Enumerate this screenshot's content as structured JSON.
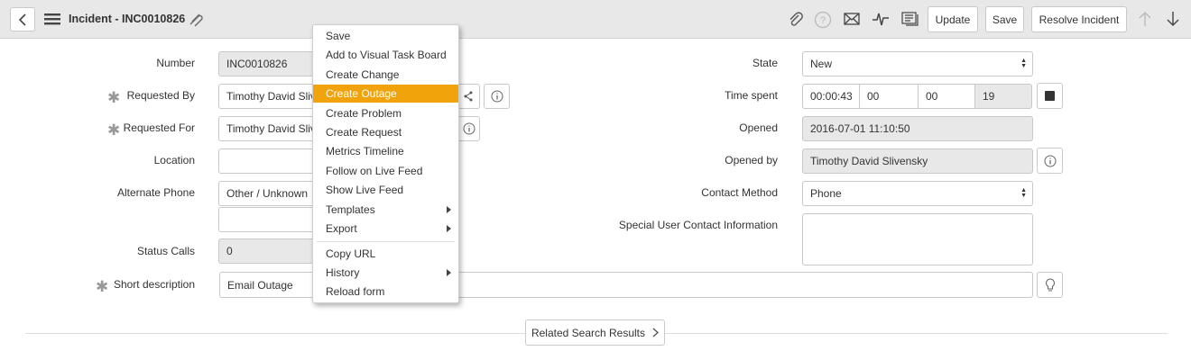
{
  "header": {
    "title": "Incident - INC0010826",
    "update_label": "Update",
    "save_label": "Save",
    "resolve_label": "Resolve Incident"
  },
  "form": {
    "number": {
      "label": "Number",
      "value": "INC0010826"
    },
    "requested_by": {
      "label": "Requested By",
      "value": "Timothy David Slivensky"
    },
    "requested_for": {
      "label": "Requested For",
      "value": "Timothy David Slivensky"
    },
    "location": {
      "label": "Location",
      "value": ""
    },
    "alternate_phone": {
      "label": "Alternate Phone",
      "value": "Other / Unknown",
      "value2": ""
    },
    "status_calls": {
      "label": "Status Calls",
      "value": "0"
    },
    "short_description": {
      "label": "Short description",
      "value": "Email Outage"
    },
    "state": {
      "label": "State",
      "value": "New"
    },
    "time_spent": {
      "label": "Time spent",
      "hours": "00:00:43",
      "h": "00",
      "m": "00",
      "s": "19"
    },
    "opened": {
      "label": "Opened",
      "value": "2016-07-01 11:10:50"
    },
    "opened_by": {
      "label": "Opened by",
      "value": "Timothy David Slivensky"
    },
    "contact_method": {
      "label": "Contact Method",
      "value": "Phone"
    },
    "special_contact": {
      "label": "Special User Contact Information",
      "value": ""
    }
  },
  "related_search_label": "Related Search Results",
  "context_menu": {
    "items": [
      {
        "label": "Save"
      },
      {
        "label": "Add to Visual Task Board"
      },
      {
        "label": "Create Change"
      },
      {
        "label": "Create Outage"
      },
      {
        "label": "Create Problem"
      },
      {
        "label": "Create Request"
      },
      {
        "label": "Metrics Timeline"
      },
      {
        "label": "Follow on Live Feed"
      },
      {
        "label": "Show Live Feed"
      },
      {
        "label": "Templates"
      },
      {
        "label": "Export"
      },
      {
        "label": "Copy URL"
      },
      {
        "label": "History"
      },
      {
        "label": "Reload form"
      }
    ]
  },
  "colors": {
    "highlight": "#f0a30a",
    "header_bg": "#e8e8e8"
  }
}
